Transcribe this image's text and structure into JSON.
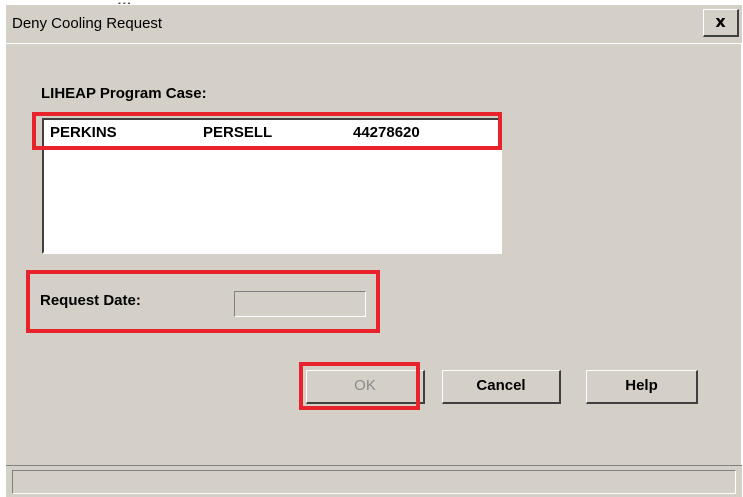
{
  "window": {
    "title": "Deny Cooling Request",
    "close_label": "x"
  },
  "program_case": {
    "label": "LIHEAP Program Case:",
    "rows": [
      {
        "last_name": "PERKINS",
        "first_name": "PERSELL",
        "case_number": "44278620"
      }
    ]
  },
  "request_date": {
    "label": "Request Date:",
    "value": ""
  },
  "buttons": {
    "ok": "OK",
    "cancel": "Cancel",
    "help": "Help"
  },
  "colors": {
    "dialog_bg": "#d4d0c8",
    "highlight": "#e8232b"
  }
}
